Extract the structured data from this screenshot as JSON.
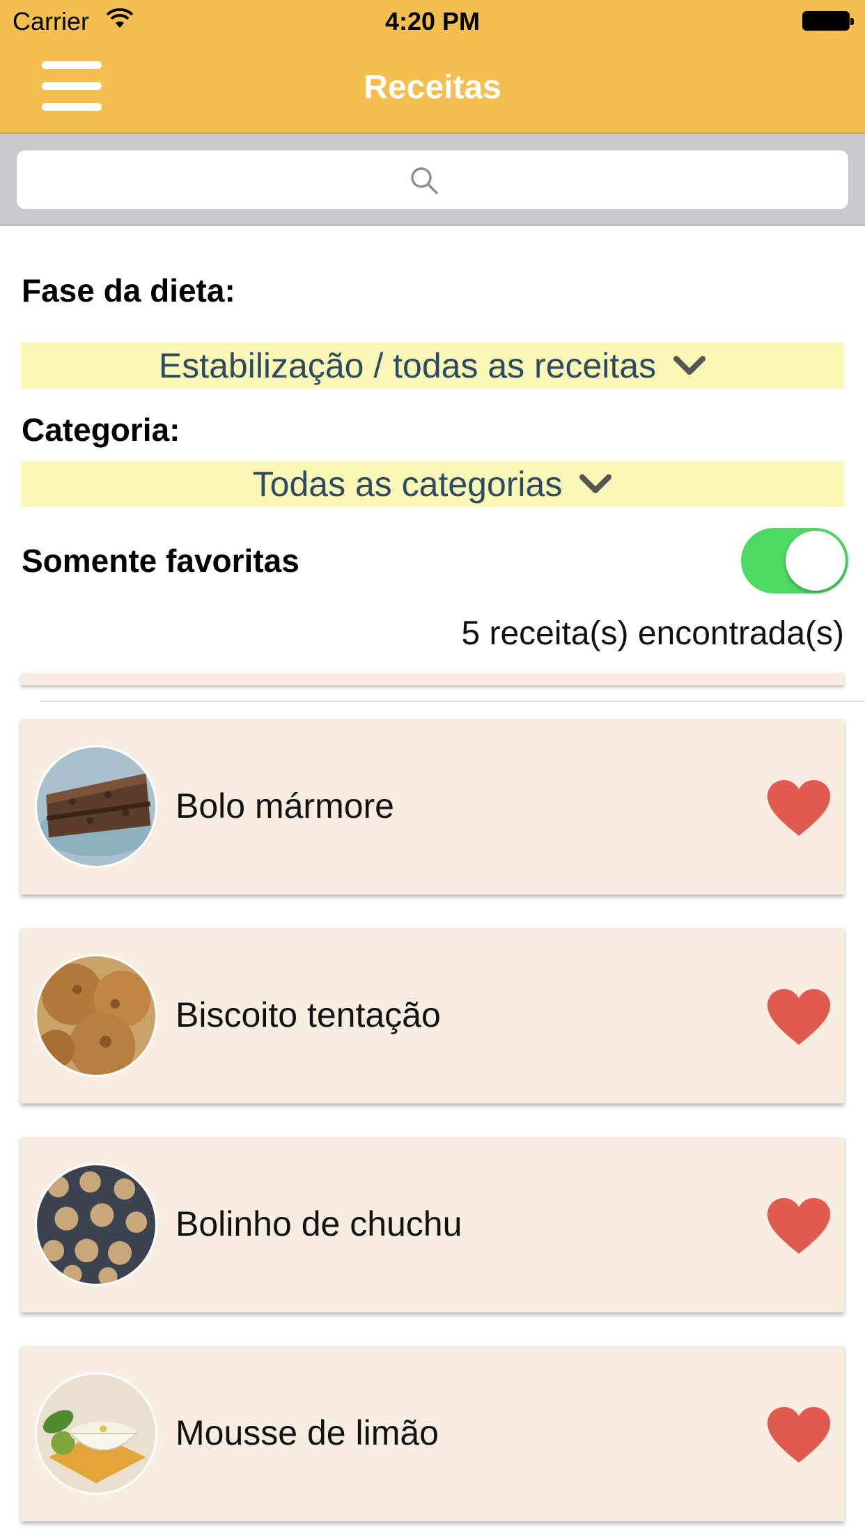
{
  "status_bar": {
    "carrier": "Carrier",
    "time": "4:20 PM"
  },
  "nav": {
    "title": "Receitas",
    "menu_icon": "hamburger-menu-icon"
  },
  "search": {
    "value": "",
    "placeholder": "",
    "icon": "search-icon"
  },
  "filters": {
    "diet_phase_label": "Fase da dieta:",
    "diet_phase_value": "Estabilização / todas as receitas",
    "category_label": "Categoria:",
    "category_value": "Todas as categorias",
    "favorites_label": "Somente favoritas",
    "favorites_on": true,
    "results_count": "5 receita(s) encontrada(s)"
  },
  "colors": {
    "nav_bar": "#f4bf4f",
    "picker_bg": "#fbf7b5",
    "picker_text": "#2b4a63",
    "toggle_on": "#4cd964",
    "card_bg": "#f7eee1",
    "heart": "#e05a4f"
  },
  "recipes": [
    {
      "name": "Bolo mármore",
      "favorite": true,
      "image": "marble-cake-photo"
    },
    {
      "name": "Biscoito tentação",
      "favorite": true,
      "image": "cookies-photo"
    },
    {
      "name": "Bolinho de chuchu",
      "favorite": true,
      "image": "chayote-fritters-photo"
    },
    {
      "name": "Mousse de limão",
      "favorite": true,
      "image": "lemon-mousse-photo"
    }
  ]
}
